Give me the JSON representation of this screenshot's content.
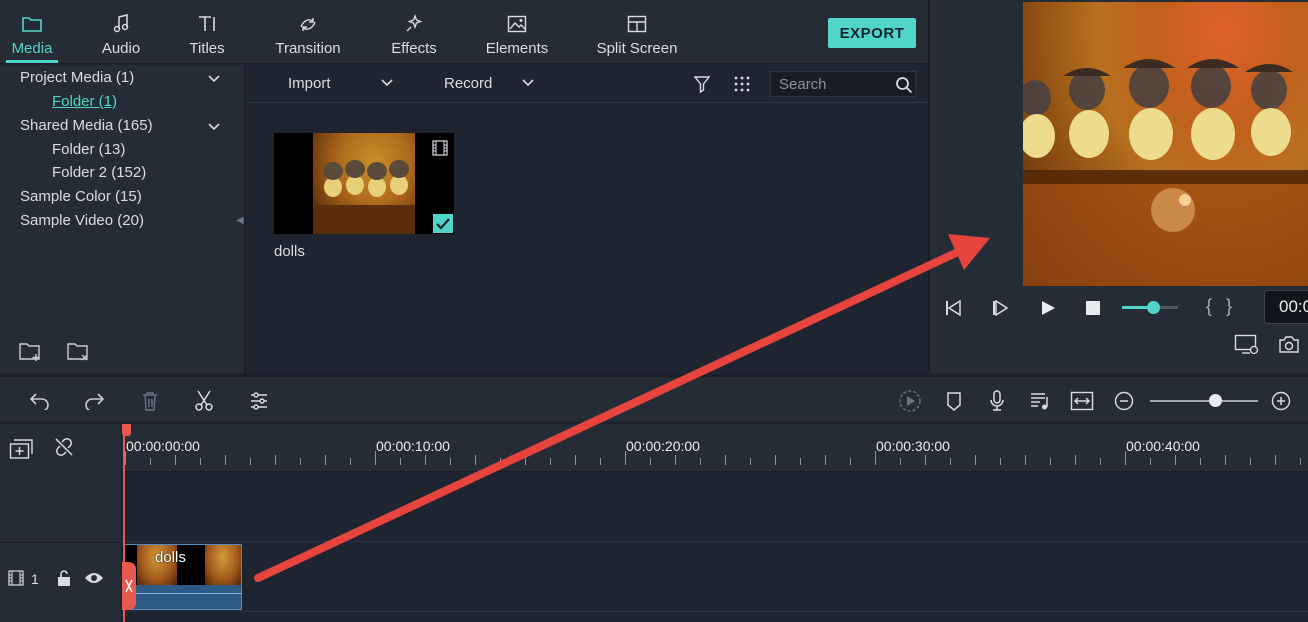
{
  "nav": {
    "tabs": [
      {
        "label": "Media",
        "icon": "folder-icon"
      },
      {
        "label": "Audio",
        "icon": "music-note-icon"
      },
      {
        "label": "Titles",
        "icon": "text-icon"
      },
      {
        "label": "Transition",
        "icon": "transition-icon"
      },
      {
        "label": "Effects",
        "icon": "sparkle-icon"
      },
      {
        "label": "Elements",
        "icon": "image-icon"
      },
      {
        "label": "Split Screen",
        "icon": "split-screen-icon"
      }
    ],
    "active": "Media",
    "export_label": "EXPORT"
  },
  "sidebar": {
    "items": [
      {
        "label": "Project Media (1)",
        "expandable": true
      },
      {
        "label": "Folder (1)",
        "selected": true
      },
      {
        "label": "Shared Media (165)",
        "expandable": true
      },
      {
        "label": "Folder (13)"
      },
      {
        "label": "Folder 2 (152)"
      },
      {
        "label": "Sample Color (15)"
      },
      {
        "label": "Sample Video (20)"
      }
    ]
  },
  "media_toolbar": {
    "import_label": "Import",
    "record_label": "Record",
    "search_placeholder": "Search"
  },
  "media": {
    "items": [
      {
        "name": "dolls",
        "selected": true
      }
    ]
  },
  "preview": {
    "timecode": "00:0"
  },
  "timeline": {
    "ruler_labels": [
      "00:00:00:00",
      "00:00:10:00",
      "00:00:20:00",
      "00:00:30:00",
      "00:00:40:00"
    ],
    "track_number": "1",
    "clip_name": "dolls",
    "zoom_level": 0.6,
    "volume_level": 0.55
  },
  "colors": {
    "accent": "#4fd6c8",
    "playhead": "#e85a4f",
    "arrow": "#e8443e"
  }
}
